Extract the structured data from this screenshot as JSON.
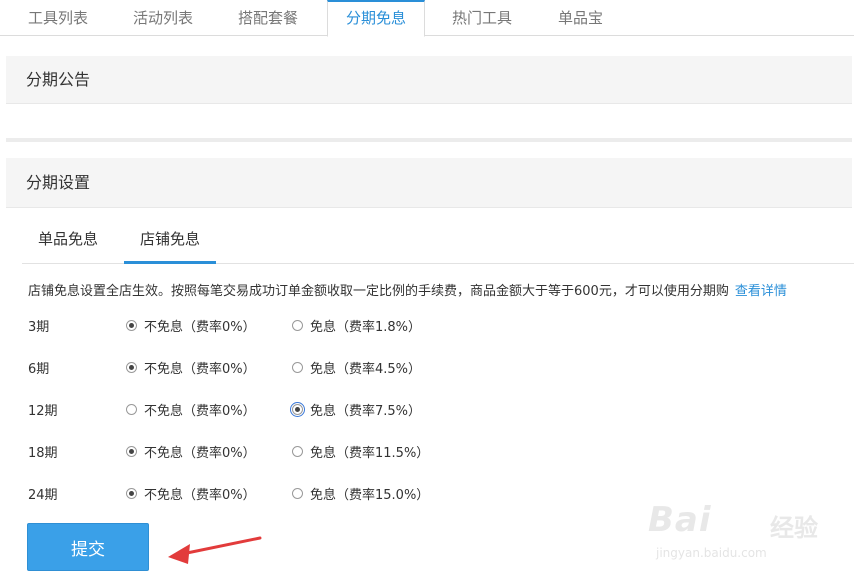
{
  "top_tabs": [
    {
      "label": "工具列表"
    },
    {
      "label": "活动列表"
    },
    {
      "label": "搭配套餐"
    },
    {
      "label": "分期免息"
    },
    {
      "label": "热门工具"
    },
    {
      "label": "单品宝"
    }
  ],
  "active_top_tab": "分期免息",
  "panel1": {
    "title": "分期公告"
  },
  "panel2": {
    "title": "分期设置"
  },
  "sub_tabs": [
    {
      "label": "单品免息"
    },
    {
      "label": "店铺免息"
    }
  ],
  "active_sub_tab": "店铺免息",
  "notice": {
    "text": "店铺免息设置全店生效。按照每笔交易成功订单金额收取一定比例的手续费，商品金额大于等于600元，才可以使用分期购",
    "link": "查看详情"
  },
  "periods": [
    {
      "label": "3期",
      "opt1": "不免息（费率0%）",
      "opt2": "免息（费率1.8%）",
      "selected": 1
    },
    {
      "label": "6期",
      "opt1": "不免息（费率0%）",
      "opt2": "免息（费率4.5%）",
      "selected": 1
    },
    {
      "label": "12期",
      "opt1": "不免息（费率0%）",
      "opt2": "免息（费率7.5%）",
      "selected": 2
    },
    {
      "label": "18期",
      "opt1": "不免息（费率0%）",
      "opt2": "免息（费率11.5%）",
      "selected": 1
    },
    {
      "label": "24期",
      "opt1": "不免息（费率0%）",
      "opt2": "免息（费率15.0%）",
      "selected": 1
    }
  ],
  "submit_label": "提交",
  "watermark": {
    "logo": "Bai",
    "logo2": "经验",
    "url": "jingyan.baidu.com"
  },
  "colors": {
    "accent": "#2a8fd8",
    "button": "#3aa0e8",
    "arrow": "#e23b3b"
  }
}
